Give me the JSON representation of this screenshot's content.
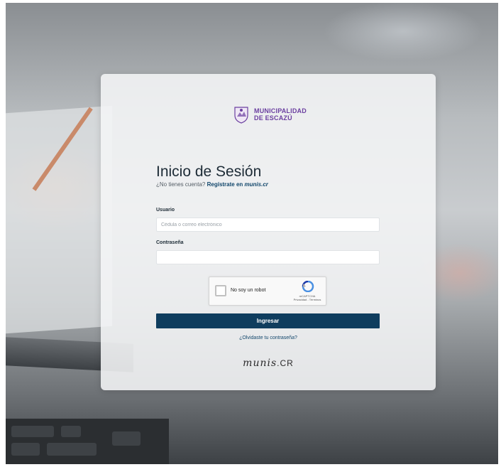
{
  "logo": {
    "line1": "MUNICIPALIDAD",
    "line2": "DE ESCAZÚ",
    "icon": "municipal-seal-icon",
    "color": "#6b3fa0"
  },
  "heading": {
    "title": "Inicio de Sesión",
    "prompt": "¿No tienes cuenta?",
    "register_link": "Regístrate en",
    "brand": "munis.cr"
  },
  "form": {
    "user_label": "Usuario",
    "user_placeholder": "Cédula o correo electrónico",
    "user_value": "",
    "password_label": "Contraseña",
    "password_value": "",
    "submit_label": "Ingresar",
    "forgot_link": "¿Olvidaste tu contraseña?"
  },
  "captcha": {
    "label": "No soy un robot",
    "brand": "reCAPTCHA",
    "links": "Privacidad - Términos"
  },
  "footer": {
    "brand_main": "munis",
    "brand_suffix": ".CR"
  },
  "colors": {
    "primary": "#0f3d5e",
    "link": "#11466b"
  }
}
